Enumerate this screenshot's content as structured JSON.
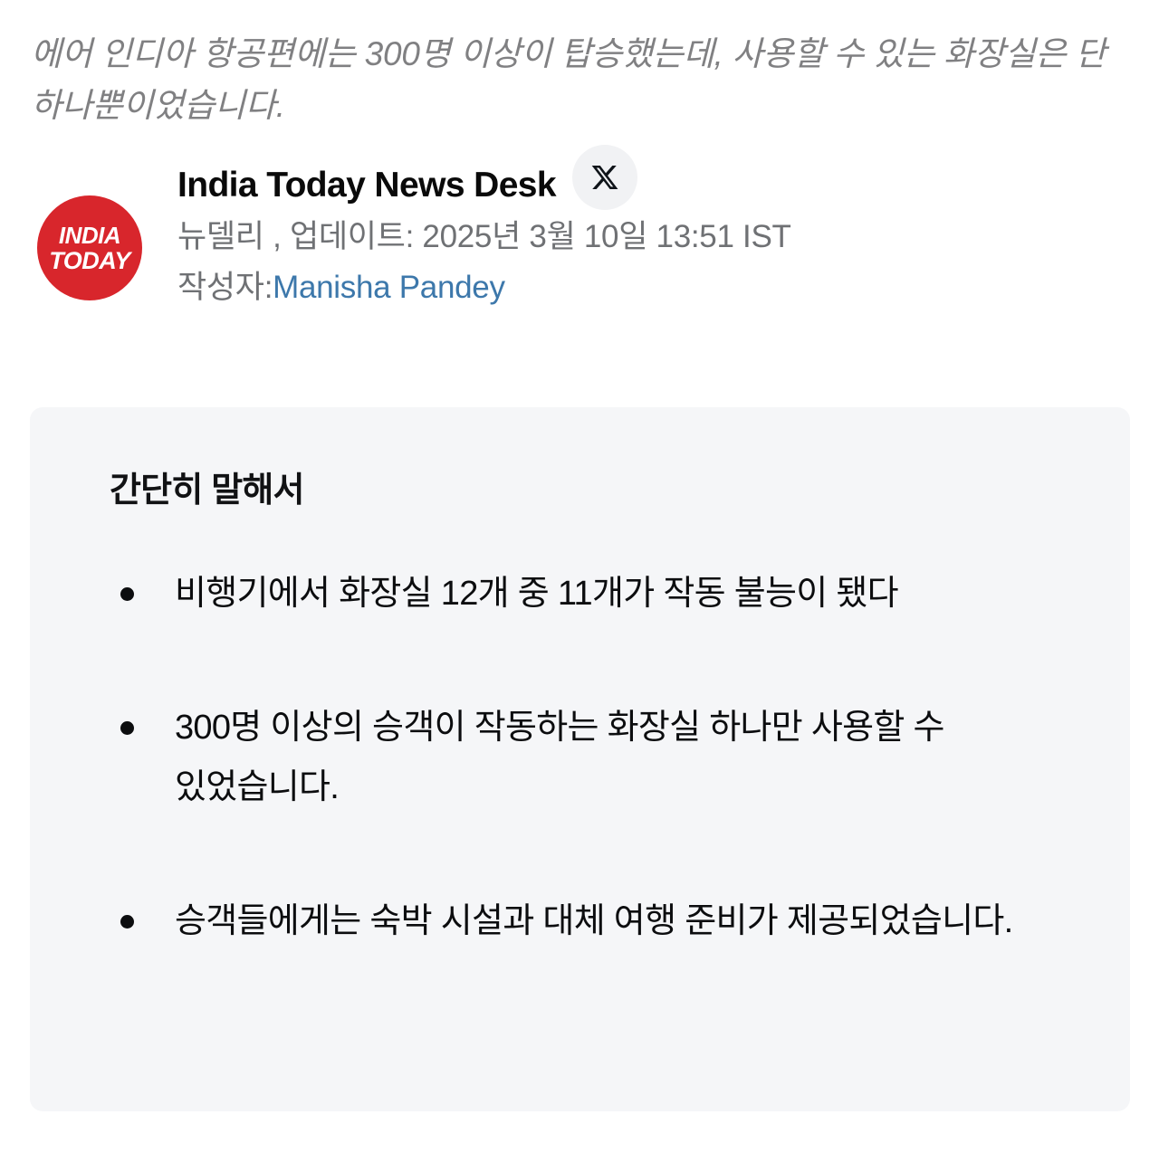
{
  "article": {
    "intro_paragraph": "에어 인디아 항공편에는 300명 이상이 탑승했는데, 사용할 수 있는 화장실은 단 하나뿐이었습니다."
  },
  "byline": {
    "logo": {
      "name": "india-today-logo",
      "line1": "INDIA",
      "line2": "TODAY",
      "circle_color": "#d8262c",
      "text_color": "#ffffff"
    },
    "desk_name": "India Today News Desk",
    "share_icon": {
      "name": "x-twitter-icon",
      "label": "X",
      "badge_color": "#f1f2f4"
    },
    "location_and_update": "뉴델리 ,  업데이트: 2025년 3월 10일 13:51 IST",
    "author_prefix": "작성자:",
    "author_name": "Manisha Pandey",
    "author_link_color": "#3d78ab"
  },
  "summary": {
    "title": "간단히 말해서",
    "background_color": "#f5f6f8",
    "bullets": [
      "비행기에서 화장실 12개 중 11개가 작동 불능이 됐다",
      "300명 이상의 승객이 작동하는 화장실 하나만 사용할 수 있었습니다.",
      "승객들에게는 숙박 시설과 대체 여행 준비가 제공되었습니다."
    ]
  }
}
